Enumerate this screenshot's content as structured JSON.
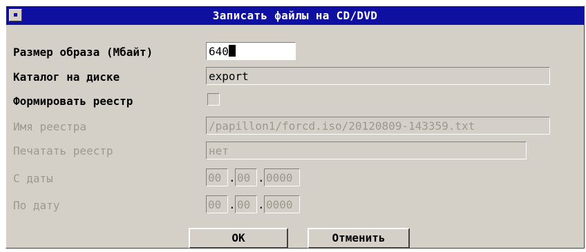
{
  "dialog": {
    "title": "Записать файлы на CD/DVD"
  },
  "fields": {
    "image_size": {
      "label": "Размер образа (Мбайт)",
      "value": "640"
    },
    "catalog": {
      "label": "Каталог на диске",
      "value": "export"
    },
    "make_registry": {
      "label": "Формировать реестр"
    },
    "registry_name": {
      "label": "Имя реестра",
      "value": "/papillon1/forcd.iso/20120809-143359.txt"
    },
    "print_registry": {
      "label": "Печатать реестр",
      "value": "нет"
    },
    "from_date": {
      "label": "С даты",
      "day": "00",
      "month": "00",
      "year": "0000",
      "sep": "."
    },
    "to_date": {
      "label": "По дату",
      "day": "00",
      "month": "00",
      "year": "0000",
      "sep": "."
    }
  },
  "buttons": {
    "ok": "OK",
    "cancel": "Отменить"
  },
  "colors": {
    "titlebar": "#1010a0",
    "face": "#d4d0c8",
    "disabled_text": "#9c9890"
  }
}
